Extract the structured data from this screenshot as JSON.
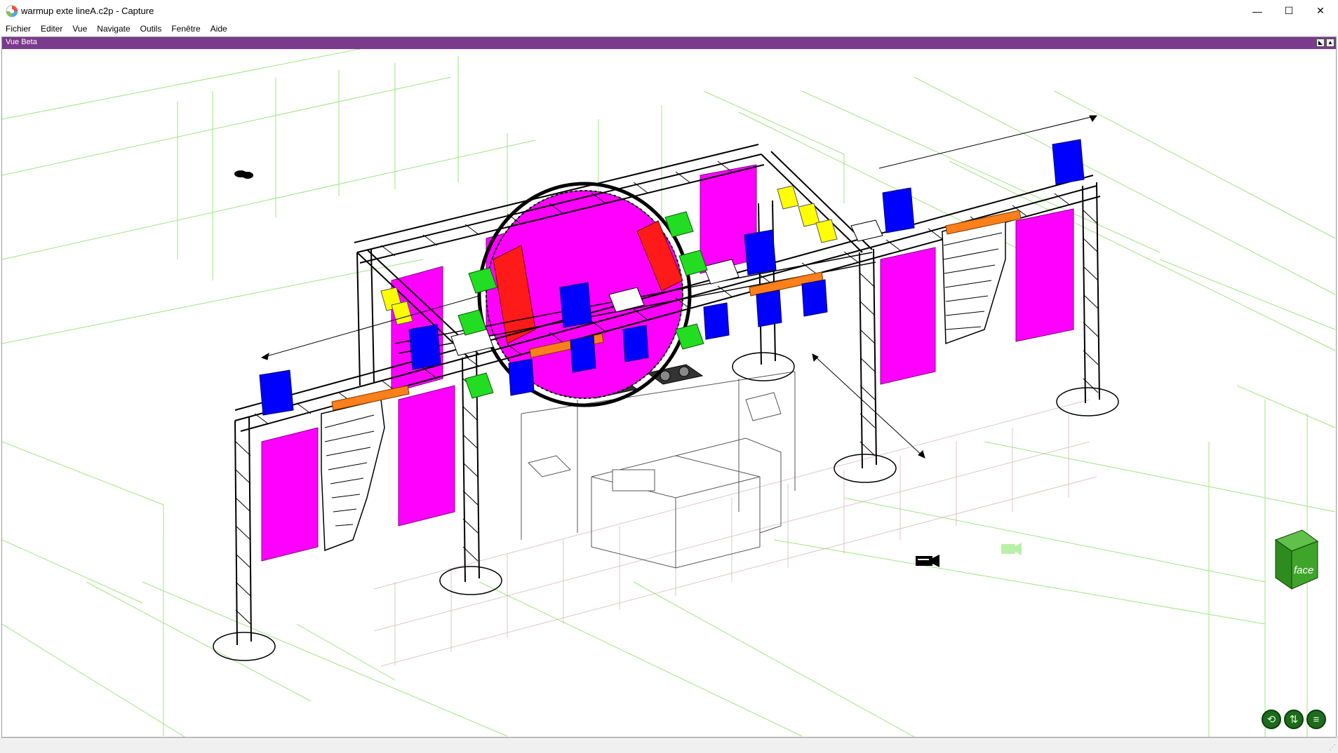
{
  "window": {
    "title": "warmup exte lineA.c2p - Capture",
    "minimize": "—",
    "maximize": "☐",
    "close": "✕"
  },
  "menu": {
    "items": [
      "Fichier",
      "Editer",
      "Vue",
      "Navigate",
      "Outils",
      "Fenêtre",
      "Aide"
    ]
  },
  "view": {
    "title": "Vue Beta",
    "cube_label": "face"
  },
  "icons": {
    "logo": "capture-logo-icon",
    "camera_active": "camera-icon",
    "camera_inactive": "camera-ghost-icon",
    "nav": [
      "orbit-icon",
      "rotate-icon",
      "menu-icon"
    ]
  },
  "colors": {
    "view_header": "#7b3a8c",
    "screen_magenta": "#ff00ff",
    "fixture_blue": "#0000ff",
    "fixture_green": "#22dd22",
    "fixture_yellow": "#ffff00",
    "fixture_red": "#ff1a1a",
    "led_bar_orange": "#ff7f1a",
    "grid_green": "#8ee06a",
    "cube_green": "#2e8b1e"
  }
}
